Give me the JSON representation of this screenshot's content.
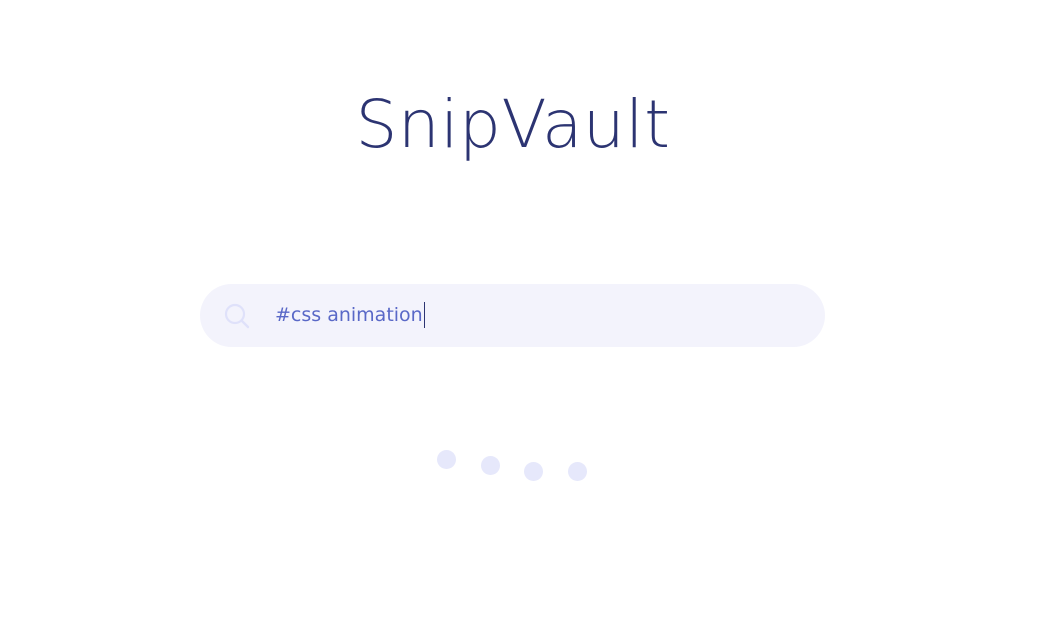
{
  "app": {
    "title": "SnipVault"
  },
  "search": {
    "value": "#css animation",
    "icon": "search-icon"
  },
  "loading": {
    "indicator": "loading-dots",
    "dot_count": 4
  },
  "colors": {
    "title": "#2c3472",
    "search_background": "#f3f3fc",
    "search_text": "#5968c7",
    "search_icon": "#dfe1fa",
    "loading_dot": "#e6e8fb"
  }
}
